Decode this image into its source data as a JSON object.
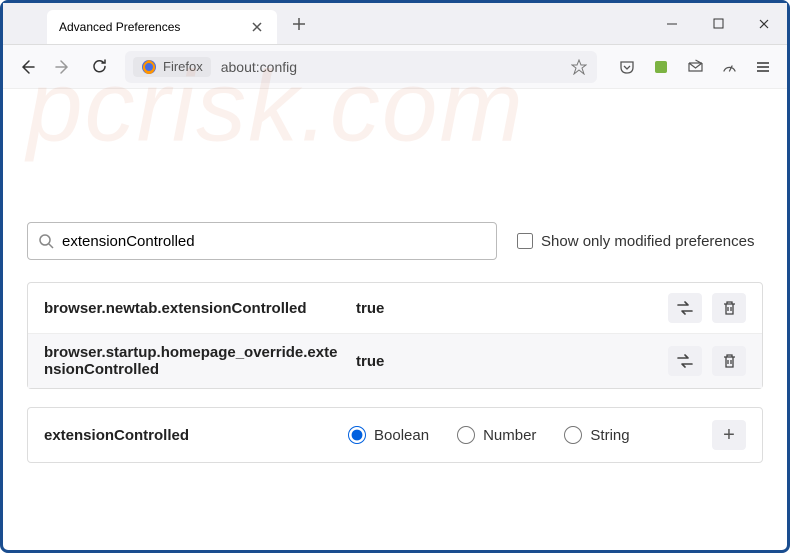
{
  "window": {
    "tab_title": "Advanced Preferences"
  },
  "urlbar": {
    "identity": "Firefox",
    "url": "about:config"
  },
  "search": {
    "value": "extensionControlled",
    "checkbox_label": "Show only modified preferences"
  },
  "preferences": [
    {
      "name": "browser.newtab.extensionControlled",
      "value": "true"
    },
    {
      "name": "browser.startup.homepage_override.extensionControlled",
      "value": "true"
    }
  ],
  "add": {
    "name": "extensionControlled",
    "types": [
      "Boolean",
      "Number",
      "String"
    ],
    "selected": 0
  },
  "watermark": "pcrisk.com"
}
